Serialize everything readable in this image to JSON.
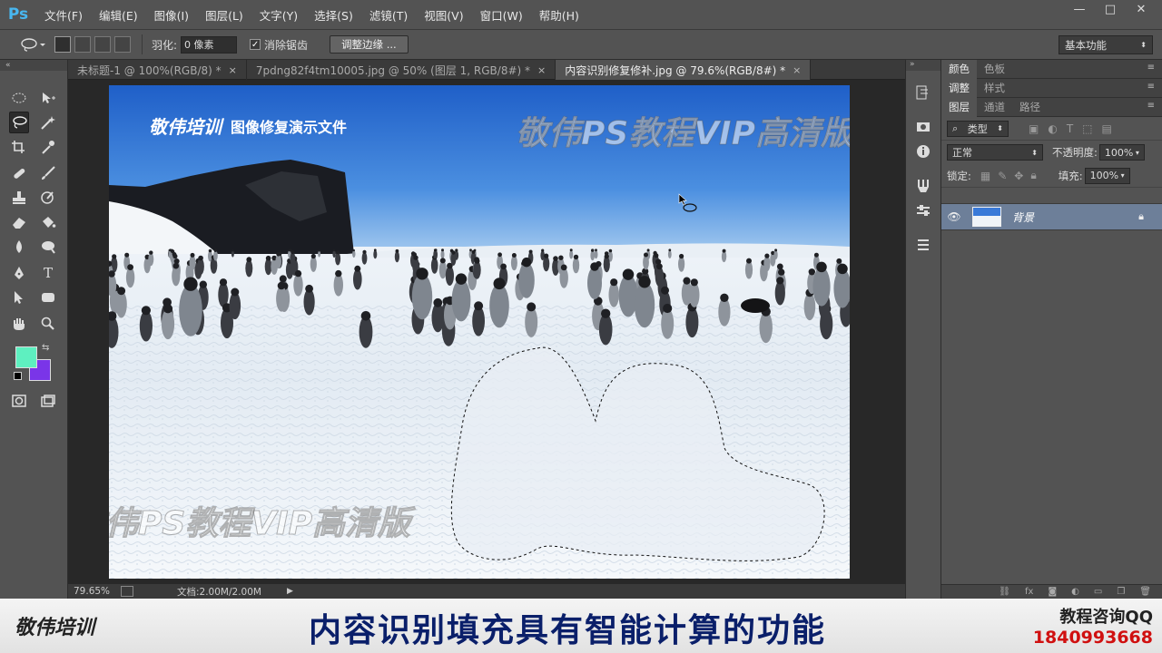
{
  "app": {
    "logo": "Ps"
  },
  "menu": [
    "文件(F)",
    "编辑(E)",
    "图像(I)",
    "图层(L)",
    "文字(Y)",
    "选择(S)",
    "滤镜(T)",
    "视图(V)",
    "窗口(W)",
    "帮助(H)"
  ],
  "window_controls": {
    "minimize": "—",
    "maximize": "□",
    "close": "✕"
  },
  "options": {
    "feather_label": "羽化:",
    "feather_value": "0 像素",
    "antialias_label": "消除锯齿",
    "antialias_checked": true,
    "refine_edge": "调整边缘 ...",
    "workspace": "基本功能"
  },
  "tabs": [
    {
      "label": "未标题-1 @ 100%(RGB/8) *",
      "active": false
    },
    {
      "label": "7pdng82f4tm10005.jpg @ 50% (图层 1, RGB/8#) *",
      "active": false
    },
    {
      "label": "内容识别修复修补.jpg @ 79.6%(RGB/8#) *",
      "active": true
    }
  ],
  "tab_close": "×",
  "document": {
    "title_logo": "敬伟培训",
    "title_text": "图像修复演示文件",
    "watermark": "敬伟PS教程VIP高清版"
  },
  "status": {
    "zoom": "79.65%",
    "doc_info": "文档:2.00M/2.00M"
  },
  "colors": {
    "foreground": "#5ef0c0",
    "background": "#7a35e8",
    "accent": "#48b7f0"
  },
  "panels": {
    "group1": [
      "颜色",
      "色板"
    ],
    "group2": [
      "调整",
      "样式"
    ],
    "group3": [
      "图层",
      "通道",
      "路径"
    ],
    "filter_kind": "类型",
    "blend_mode": "正常",
    "opacity_label": "不透明度:",
    "opacity_value": "100%",
    "lock_label": "锁定:",
    "fill_label": "填充:",
    "fill_value": "100%",
    "layer_name": "背景"
  },
  "banner": {
    "left_brand": "敬伟培训",
    "caption": "内容识别填充具有智能计算的功能",
    "contact_label": "教程咨询QQ",
    "contact_qq": "1840993668"
  }
}
